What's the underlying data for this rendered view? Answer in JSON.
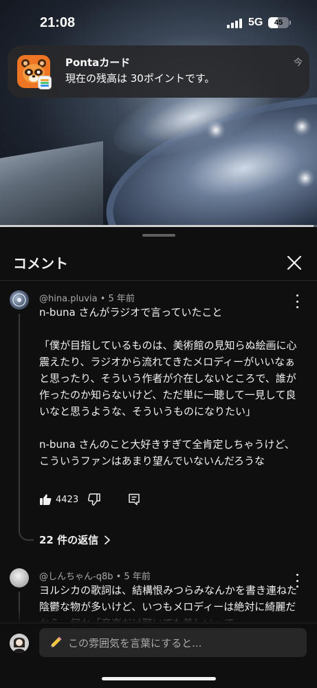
{
  "status_bar": {
    "time": "21:08",
    "network": "5G",
    "battery_level": "45",
    "battery_fraction": 0.45
  },
  "notification": {
    "app_name": "Pontaカード",
    "message": "現在の残高は 30ポイントです。",
    "time": "今",
    "icon": "ponta-raccoon-icon",
    "accent_color": "#ee7523"
  },
  "video": {
    "progress_fraction": 0.99
  },
  "comments_panel": {
    "title": "コメント",
    "close_icon": "close-icon"
  },
  "comments": [
    {
      "author": "@hina.pluvia",
      "age": "5 年前",
      "text": "n-buna さんがラジオで言っていたこと\n\n「僕が目指しているものは、美術館の見知らぬ絵画に心震えたり、ラジオから流れてきたメロディーがいいなぁと思ったり、そういう作者が介在しないところで、誰が作ったのか知らないけど、ただ単に一聴して一見して良いなと思うような、そういうものになりたい」\n\nn-buna さんのこと大好きすぎて全肯定しちゃうけど、こういうファンはあまり望んでいないんだろうな",
      "likes": "4423",
      "replies_label": "22 件の返信"
    },
    {
      "author": "@しんちゃん-q8b",
      "age": "5 年前",
      "text": "ヨルシカの歌詞は、結構恨みつらみなんかを書き連ねた陰鬱な物が多いけど、いつもメロディーは絶対に綺麗だから、何か「音楽だけ聴いても美しい」て"
    }
  ],
  "composer": {
    "placeholder": "この雰囲気を言葉にすると...",
    "icon": "pencil-icon"
  }
}
